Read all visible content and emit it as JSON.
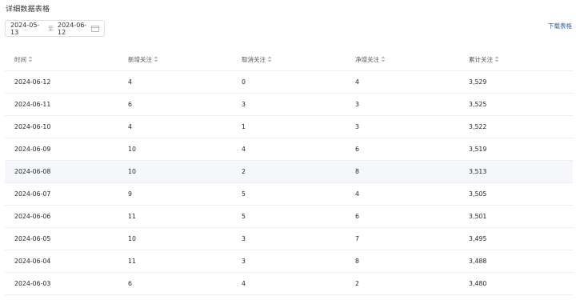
{
  "section_title": "详细数据表格",
  "date_range": {
    "start": "2024-05-13",
    "separator": "至",
    "end": "2024-06-12",
    "icon": "calendar-icon"
  },
  "download_label": "下载表格",
  "table": {
    "headers": [
      "时间",
      "新增关注",
      "取消关注",
      "净增关注",
      "累计关注"
    ],
    "rows": [
      [
        "2024-06-12",
        "4",
        "0",
        "4",
        "3,529"
      ],
      [
        "2024-06-11",
        "6",
        "3",
        "3",
        "3,525"
      ],
      [
        "2024-06-10",
        "4",
        "1",
        "3",
        "3,522"
      ],
      [
        "2024-06-09",
        "10",
        "4",
        "6",
        "3,519"
      ],
      [
        "2024-06-08",
        "10",
        "2",
        "8",
        "3,513"
      ],
      [
        "2024-06-07",
        "9",
        "5",
        "4",
        "3,505"
      ],
      [
        "2024-06-06",
        "11",
        "5",
        "6",
        "3,501"
      ],
      [
        "2024-06-05",
        "10",
        "3",
        "7",
        "3,495"
      ],
      [
        "2024-06-04",
        "11",
        "3",
        "8",
        "3,488"
      ],
      [
        "2024-06-03",
        "6",
        "4",
        "2",
        "3,480"
      ]
    ],
    "highlighted_row": 4
  },
  "colors": {
    "link": "#2a5caa",
    "row_hover": "#f5f7fa",
    "border": "#ebeef5"
  }
}
